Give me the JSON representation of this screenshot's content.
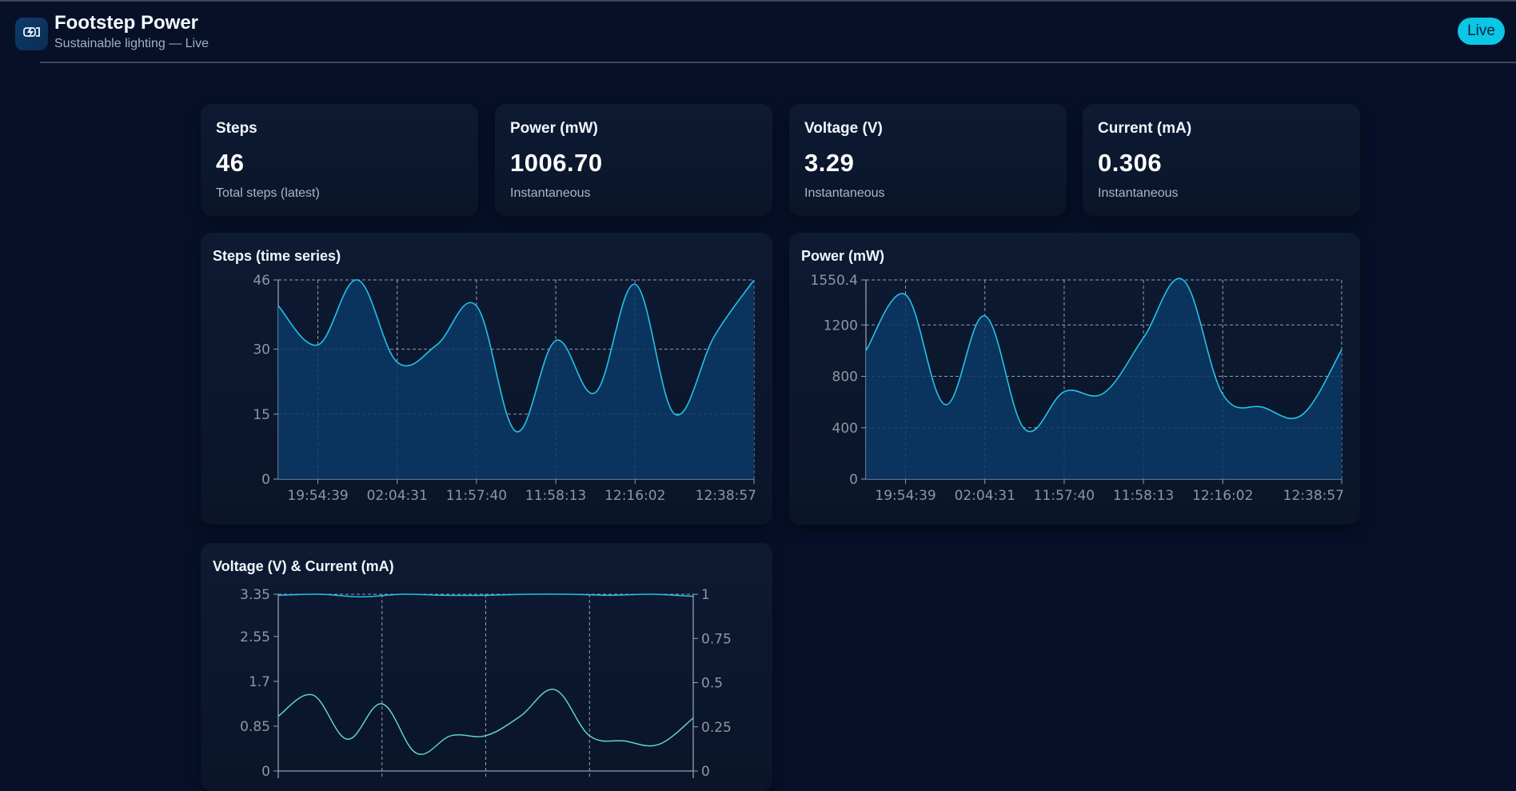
{
  "app": {
    "title": "Footstep Power",
    "subtitle": "Sustainable lighting — Live",
    "status_badge": "Live",
    "logo_icon": "bolt-icon"
  },
  "colors": {
    "background": "#071028",
    "accent": "#0cc6e5",
    "line_primary": "#22c3e6",
    "line_secondary": "#5fd4c8",
    "fill": "#0a3866"
  },
  "stats": [
    {
      "label": "Steps",
      "value": "46",
      "sub": "Total steps (latest)"
    },
    {
      "label": "Power (mW)",
      "value": "1006.70",
      "sub": "Instantaneous"
    },
    {
      "label": "Voltage (V)",
      "value": "3.29",
      "sub": "Instantaneous"
    },
    {
      "label": "Current (mA)",
      "value": "0.306",
      "sub": "Instantaneous"
    }
  ],
  "charts": {
    "steps_title": "Steps (time series)",
    "power_title": "Power (mW)",
    "vc_title": "Voltage (V) & Current (mA)"
  },
  "chart_data": [
    {
      "type": "area",
      "title": "Steps (time series)",
      "x": [
        "",
        "19:54:39",
        "",
        "02:04:31",
        "",
        "11:57:40",
        "",
        "11:58:13",
        "",
        "12:16:02",
        "",
        "",
        "12:38:57"
      ],
      "series": [
        {
          "values": [
            40,
            31,
            46,
            27,
            31,
            40,
            11,
            32,
            20,
            45,
            15,
            33,
            46
          ]
        }
      ],
      "ylim": [
        0,
        46
      ],
      "yticks": [
        "0",
        "15",
        "30",
        "46"
      ],
      "xticks": [
        "19:54:39",
        "02:04:31",
        "11:57:40",
        "11:58:13",
        "12:16:02",
        "12:38:57"
      ],
      "grid": true
    },
    {
      "type": "area",
      "title": "Power (mW)",
      "x": [
        "",
        "19:54:39",
        "",
        "02:04:31",
        "",
        "11:57:40",
        "",
        "11:58:13",
        "",
        "12:16:02",
        "",
        "",
        "12:38:57"
      ],
      "series": [
        {
          "values": [
            1000,
            1435,
            580,
            1270,
            390,
            680,
            670,
            1100,
            1550.4,
            660,
            560,
            500,
            1006.7
          ]
        }
      ],
      "ylim": [
        0,
        1550.4
      ],
      "yticks": [
        "0",
        "400",
        "800",
        "1200",
        "1550.4"
      ],
      "xticks": [
        "19:54:39",
        "02:04:31",
        "11:57:40",
        "11:58:13",
        "12:16:02",
        "12:38:57"
      ],
      "grid": true
    },
    {
      "type": "line",
      "title": "Voltage (V) & Current (mA)",
      "series": [
        {
          "axis": "left",
          "values": [
            3.33,
            3.35,
            3.3,
            3.35,
            3.33,
            3.33,
            3.35,
            3.35,
            3.33,
            3.35,
            3.31
          ]
        },
        {
          "axis": "right",
          "values": [
            0.31,
            0.43,
            0.18,
            0.38,
            0.1,
            0.2,
            0.2,
            0.31,
            0.46,
            0.2,
            0.17,
            0.15,
            0.3
          ]
        }
      ],
      "ylim_left": [
        0,
        3.35
      ],
      "ylim_right": [
        0,
        1
      ],
      "yticks_left": [
        "0",
        "0.85",
        "1.7",
        "2.55",
        "3.35"
      ],
      "yticks_right": [
        "0",
        "0.25",
        "0.5",
        "0.75",
        "1"
      ],
      "grid": true
    }
  ]
}
